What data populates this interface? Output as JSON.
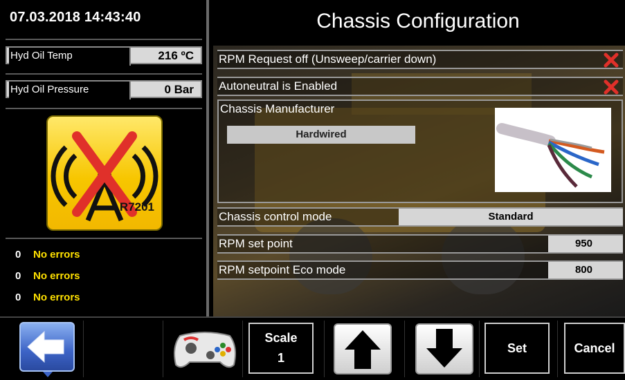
{
  "header": {
    "datetime": "07.03.2018 14:43:40",
    "title": "Chassis Configuration"
  },
  "left": {
    "oil_temp": {
      "label": "Hyd Oil Temp",
      "value": "216 ºC"
    },
    "oil_pressure": {
      "label": "Hyd Oil Pressure",
      "value": "0 Bar"
    },
    "badge": {
      "text": "R7201",
      "icon": "signal-disabled-icon"
    },
    "errors": [
      {
        "count": "0",
        "text": "No errors"
      },
      {
        "count": "0",
        "text": "No errors"
      },
      {
        "count": "0",
        "text": "No errors"
      }
    ]
  },
  "settings": {
    "rpm_request_off": {
      "label": "RPM Request off (Unsweep/carrier down)",
      "state_icon": "red-x-icon"
    },
    "autoneutral": {
      "label": "Autoneutral is Enabled",
      "state_icon": "red-x-icon"
    },
    "manufacturer": {
      "label": "Chassis Manufacturer",
      "value": "Hardwired",
      "image": "cable-wires-image"
    },
    "control_mode": {
      "label": "Chassis control mode",
      "value": "Standard"
    },
    "rpm_set_point": {
      "label": "RPM set point",
      "value": "950"
    },
    "rpm_eco": {
      "label": "RPM setpoint Eco mode",
      "value": "800"
    }
  },
  "toolbar": {
    "back_icon": "back-arrow-icon",
    "gamepad_icon": "gamepad-icon",
    "scale_label": "Scale",
    "scale_value": "1",
    "up_icon": "arrow-up-icon",
    "down_icon": "arrow-down-icon",
    "set_label": "Set",
    "cancel_label": "Cancel"
  },
  "colors": {
    "accent_yellow": "#ffe100",
    "badge_yellow": "#f7c600",
    "error_red": "#e0302a"
  }
}
